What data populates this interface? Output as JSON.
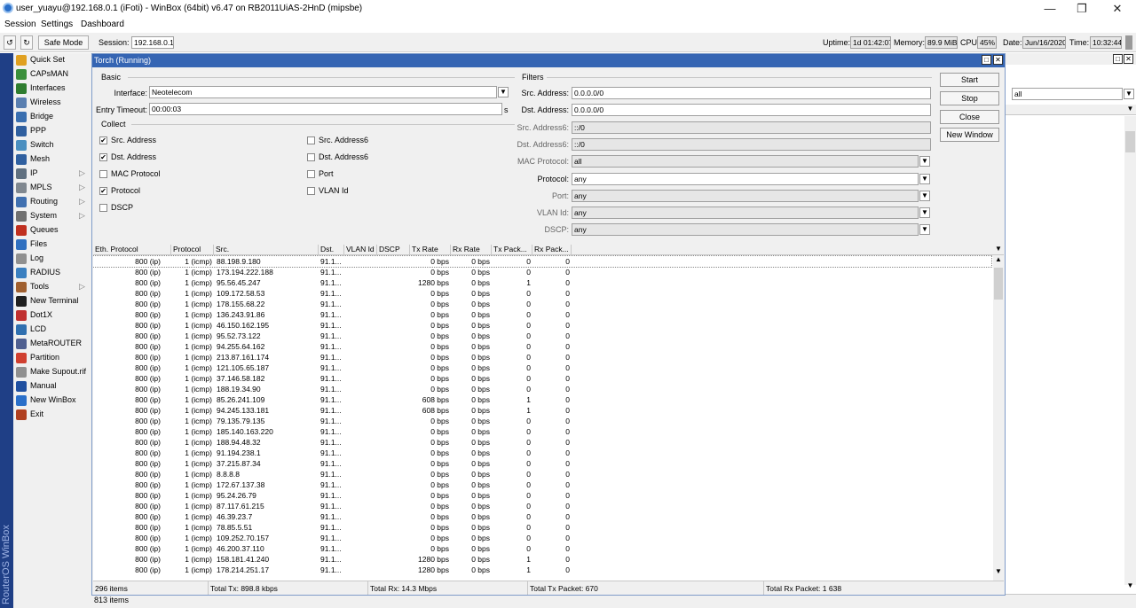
{
  "window": {
    "title": "user_yuayu@192.168.0.1 (iFoti) - WinBox (64bit) v6.47 on RB2011UiAS-2HnD (mipsbe)"
  },
  "menu": [
    "Session",
    "Settings",
    "Dashboard"
  ],
  "toolbar": {
    "safe_mode": "Safe Mode",
    "session_label": "Session:",
    "session_value": "192.168.0.1",
    "uptime_label": "Uptime:",
    "uptime_value": "1d 01:42:07",
    "memory_label": "Memory:",
    "memory_value": "89.9 MiB",
    "cpu_label": "CPU:",
    "cpu_value": "45%",
    "date_label": "Date:",
    "date_value": "Jun/16/2020",
    "time_label": "Time:",
    "time_value": "10:32:44"
  },
  "brand": "RouterOS WinBox",
  "sidebar": [
    {
      "label": "Quick Set",
      "icon": "quick-set-icon",
      "color": "#e0a020",
      "arrow": false
    },
    {
      "label": "CAPsMAN",
      "icon": "capsman-icon",
      "color": "#3a8f3a",
      "arrow": false
    },
    {
      "label": "Interfaces",
      "icon": "interfaces-icon",
      "color": "#2f7d2f",
      "arrow": false
    },
    {
      "label": "Wireless",
      "icon": "wireless-icon",
      "color": "#5a7fb0",
      "arrow": false
    },
    {
      "label": "Bridge",
      "icon": "bridge-icon",
      "color": "#3a6fb0",
      "arrow": false
    },
    {
      "label": "PPP",
      "icon": "ppp-icon",
      "color": "#2f5f9f",
      "arrow": false
    },
    {
      "label": "Switch",
      "icon": "switch-icon",
      "color": "#4a8fc0",
      "arrow": false
    },
    {
      "label": "Mesh",
      "icon": "mesh-icon",
      "color": "#3060a0",
      "arrow": false
    },
    {
      "label": "IP",
      "icon": "ip-icon",
      "color": "#607080",
      "arrow": true
    },
    {
      "label": "MPLS",
      "icon": "mpls-icon",
      "color": "#808890",
      "arrow": true
    },
    {
      "label": "Routing",
      "icon": "routing-icon",
      "color": "#4070b0",
      "arrow": true
    },
    {
      "label": "System",
      "icon": "system-icon",
      "color": "#707070",
      "arrow": true
    },
    {
      "label": "Queues",
      "icon": "queues-icon",
      "color": "#c03020",
      "arrow": false
    },
    {
      "label": "Files",
      "icon": "files-icon",
      "color": "#3070c0",
      "arrow": false
    },
    {
      "label": "Log",
      "icon": "log-icon",
      "color": "#909090",
      "arrow": false
    },
    {
      "label": "RADIUS",
      "icon": "radius-icon",
      "color": "#3a7fc0",
      "arrow": false
    },
    {
      "label": "Tools",
      "icon": "tools-icon",
      "color": "#a06030",
      "arrow": true
    },
    {
      "label": "New Terminal",
      "icon": "terminal-icon",
      "color": "#202020",
      "arrow": false
    },
    {
      "label": "Dot1X",
      "icon": "dot1x-icon",
      "color": "#c03030",
      "arrow": false
    },
    {
      "label": "LCD",
      "icon": "lcd-icon",
      "color": "#3070b0",
      "arrow": false
    },
    {
      "label": "MetaROUTER",
      "icon": "metarouter-icon",
      "color": "#506090",
      "arrow": false
    },
    {
      "label": "Partition",
      "icon": "partition-icon",
      "color": "#d04030",
      "arrow": false
    },
    {
      "label": "Make Supout.rif",
      "icon": "supout-icon",
      "color": "#909090",
      "arrow": false
    },
    {
      "label": "Manual",
      "icon": "manual-icon",
      "color": "#2050a0",
      "arrow": false
    },
    {
      "label": "New WinBox",
      "icon": "winbox-icon",
      "color": "#2a6fc9",
      "arrow": false
    },
    {
      "label": "Exit",
      "icon": "exit-icon",
      "color": "#b04020",
      "arrow": false
    }
  ],
  "torch": {
    "title": "Torch (Running)",
    "basic_group": "Basic",
    "interface_label": "Interface:",
    "interface_value": "Neotelecom",
    "timeout_label": "Entry Timeout:",
    "timeout_value": "00:00:03",
    "timeout_unit": "s",
    "collect_group": "Collect",
    "collect": [
      {
        "label": "Src. Address",
        "checked": true
      },
      {
        "label": "Dst. Address",
        "checked": true
      },
      {
        "label": "MAC Protocol",
        "checked": false
      },
      {
        "label": "Protocol",
        "checked": true
      },
      {
        "label": "DSCP",
        "checked": false
      },
      {
        "label": "Src. Address6",
        "checked": false
      },
      {
        "label": "Dst. Address6",
        "checked": false
      },
      {
        "label": "Port",
        "checked": false
      },
      {
        "label": "VLAN Id",
        "checked": false
      }
    ],
    "filters_group": "Filters",
    "filters": [
      {
        "label": "Src. Address:",
        "value": "0.0.0.0/0",
        "dim": false,
        "dropdown": false,
        "gray": false
      },
      {
        "label": "Dst. Address:",
        "value": "0.0.0.0/0",
        "dim": false,
        "dropdown": false,
        "gray": false
      },
      {
        "label": "Src. Address6:",
        "value": "::/0",
        "dim": true,
        "dropdown": false,
        "gray": true
      },
      {
        "label": "Dst. Address6:",
        "value": "::/0",
        "dim": true,
        "dropdown": false,
        "gray": true
      },
      {
        "label": "MAC Protocol:",
        "value": "all",
        "dim": true,
        "dropdown": true,
        "gray": true
      },
      {
        "label": "Protocol:",
        "value": "any",
        "dim": false,
        "dropdown": true,
        "gray": false
      },
      {
        "label": "Port:",
        "value": "any",
        "dim": true,
        "dropdown": true,
        "gray": true
      },
      {
        "label": "VLAN Id:",
        "value": "any",
        "dim": true,
        "dropdown": true,
        "gray": true
      },
      {
        "label": "DSCP:",
        "value": "any",
        "dim": true,
        "dropdown": true,
        "gray": true
      }
    ],
    "buttons": [
      "Start",
      "Stop",
      "Close",
      "New Window"
    ],
    "columns": [
      "Eth. Protocol",
      "Protocol",
      "Src.",
      "Dst.",
      "VLAN Id",
      "DSCP",
      "Tx Rate",
      "Rx Rate",
      "Tx Pack...",
      "Rx Pack..."
    ],
    "rows": [
      [
        "800 (ip)",
        "1 (icmp)",
        "88.198.9.180",
        "91.1...",
        "0 bps",
        "0 bps",
        "0",
        "0"
      ],
      [
        "800 (ip)",
        "1 (icmp)",
        "173.194.222.188",
        "91.1...",
        "0 bps",
        "0 bps",
        "0",
        "0"
      ],
      [
        "800 (ip)",
        "1 (icmp)",
        "95.56.45.247",
        "91.1...",
        "1280 bps",
        "0 bps",
        "1",
        "0"
      ],
      [
        "800 (ip)",
        "1 (icmp)",
        "109.172.58.53",
        "91.1...",
        "0 bps",
        "0 bps",
        "0",
        "0"
      ],
      [
        "800 (ip)",
        "1 (icmp)",
        "178.155.68.22",
        "91.1...",
        "0 bps",
        "0 bps",
        "0",
        "0"
      ],
      [
        "800 (ip)",
        "1 (icmp)",
        "136.243.91.86",
        "91.1...",
        "0 bps",
        "0 bps",
        "0",
        "0"
      ],
      [
        "800 (ip)",
        "1 (icmp)",
        "46.150.162.195",
        "91.1...",
        "0 bps",
        "0 bps",
        "0",
        "0"
      ],
      [
        "800 (ip)",
        "1 (icmp)",
        "95.52.73.122",
        "91.1...",
        "0 bps",
        "0 bps",
        "0",
        "0"
      ],
      [
        "800 (ip)",
        "1 (icmp)",
        "94.255.64.162",
        "91.1...",
        "0 bps",
        "0 bps",
        "0",
        "0"
      ],
      [
        "800 (ip)",
        "1 (icmp)",
        "213.87.161.174",
        "91.1...",
        "0 bps",
        "0 bps",
        "0",
        "0"
      ],
      [
        "800 (ip)",
        "1 (icmp)",
        "121.105.65.187",
        "91.1...",
        "0 bps",
        "0 bps",
        "0",
        "0"
      ],
      [
        "800 (ip)",
        "1 (icmp)",
        "37.146.58.182",
        "91.1...",
        "0 bps",
        "0 bps",
        "0",
        "0"
      ],
      [
        "800 (ip)",
        "1 (icmp)",
        "188.19.34.90",
        "91.1...",
        "0 bps",
        "0 bps",
        "0",
        "0"
      ],
      [
        "800 (ip)",
        "1 (icmp)",
        "85.26.241.109",
        "91.1...",
        "608 bps",
        "0 bps",
        "1",
        "0"
      ],
      [
        "800 (ip)",
        "1 (icmp)",
        "94.245.133.181",
        "91.1...",
        "608 bps",
        "0 bps",
        "1",
        "0"
      ],
      [
        "800 (ip)",
        "1 (icmp)",
        "79.135.79.135",
        "91.1...",
        "0 bps",
        "0 bps",
        "0",
        "0"
      ],
      [
        "800 (ip)",
        "1 (icmp)",
        "185.140.163.220",
        "91.1...",
        "0 bps",
        "0 bps",
        "0",
        "0"
      ],
      [
        "800 (ip)",
        "1 (icmp)",
        "188.94.48.32",
        "91.1...",
        "0 bps",
        "0 bps",
        "0",
        "0"
      ],
      [
        "800 (ip)",
        "1 (icmp)",
        "91.194.238.1",
        "91.1...",
        "0 bps",
        "0 bps",
        "0",
        "0"
      ],
      [
        "800 (ip)",
        "1 (icmp)",
        "37.215.87.34",
        "91.1...",
        "0 bps",
        "0 bps",
        "0",
        "0"
      ],
      [
        "800 (ip)",
        "1 (icmp)",
        "8.8.8.8",
        "91.1...",
        "0 bps",
        "0 bps",
        "0",
        "0"
      ],
      [
        "800 (ip)",
        "1 (icmp)",
        "172.67.137.38",
        "91.1...",
        "0 bps",
        "0 bps",
        "0",
        "0"
      ],
      [
        "800 (ip)",
        "1 (icmp)",
        "95.24.26.79",
        "91.1...",
        "0 bps",
        "0 bps",
        "0",
        "0"
      ],
      [
        "800 (ip)",
        "1 (icmp)",
        "87.117.61.215",
        "91.1...",
        "0 bps",
        "0 bps",
        "0",
        "0"
      ],
      [
        "800 (ip)",
        "1 (icmp)",
        "46.39.23.7",
        "91.1...",
        "0 bps",
        "0 bps",
        "0",
        "0"
      ],
      [
        "800 (ip)",
        "1 (icmp)",
        "78.85.5.51",
        "91.1...",
        "0 bps",
        "0 bps",
        "0",
        "0"
      ],
      [
        "800 (ip)",
        "1 (icmp)",
        "109.252.70.157",
        "91.1...",
        "0 bps",
        "0 bps",
        "0",
        "0"
      ],
      [
        "800 (ip)",
        "1 (icmp)",
        "46.200.37.110",
        "91.1...",
        "0 bps",
        "0 bps",
        "0",
        "0"
      ],
      [
        "800 (ip)",
        "1 (icmp)",
        "158.181.41.240",
        "91.1...",
        "1280 bps",
        "0 bps",
        "1",
        "0"
      ],
      [
        "800 (ip)",
        "1 (icmp)",
        "178.214.251.17",
        "91.1...",
        "1280 bps",
        "0 bps",
        "1",
        "0"
      ]
    ],
    "status": {
      "items": "296 items",
      "total_tx": "Total Tx: 898.8 kbps",
      "total_rx": "Total Rx: 14.3 Mbps",
      "total_tx_packet": "Total Tx Packet: 670",
      "total_rx_packet": "Total Rx Packet: 1 638"
    }
  },
  "background_window": {
    "filter_value": "all",
    "items": "813 items"
  }
}
